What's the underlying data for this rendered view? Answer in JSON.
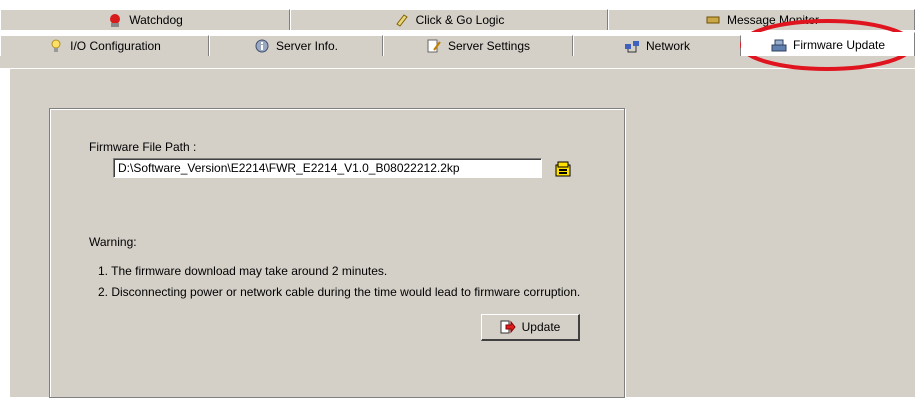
{
  "tabs_top": [
    {
      "label": "Watchdog",
      "icon": "watchdog-icon"
    },
    {
      "label": "Click & Go Logic",
      "icon": "logic-icon"
    },
    {
      "label": "Message Monitor",
      "icon": "message-monitor-icon"
    }
  ],
  "tabs_bottom": [
    {
      "label": "I/O Configuration",
      "icon": "lightbulb-icon"
    },
    {
      "label": "Server Info.",
      "icon": "info-icon"
    },
    {
      "label": "Server Settings",
      "icon": "settings-icon"
    },
    {
      "label": "Network",
      "icon": "network-icon"
    },
    {
      "label": "Firmware Update",
      "icon": "firmware-icon",
      "active": true
    }
  ],
  "firmware": {
    "path_label": "Firmware File Path :",
    "path_value": "D:\\Software_Version\\E2214\\FWR_E2214_V1.0_B08022212.2kp",
    "warning_title": "Warning:",
    "warning_1": "1. The firmware download may take around 2 minutes.",
    "warning_2": "2. Disconnecting power or network cable during the time would  lead to firmware corruption.",
    "update_label": "Update"
  },
  "colors": {
    "panel_bg": "#d4d0c8",
    "highlight": "#e0141e"
  }
}
